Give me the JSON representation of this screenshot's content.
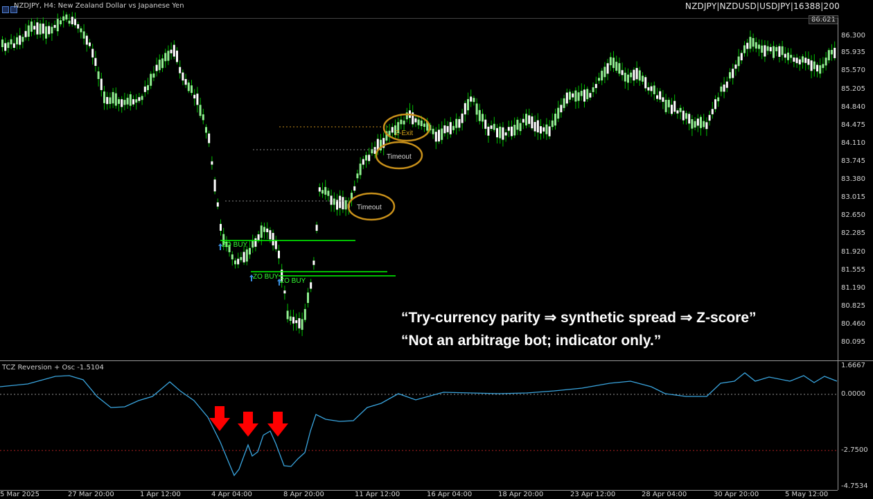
{
  "window": {
    "title": "NZDJPY, H4:  New Zealand Dollar vs Japanese Yen",
    "symbols": "NZDJPY|NZDUSD|USDJPY|16388|200",
    "current_price": "86.621"
  },
  "price_axis": {
    "labels": [
      "86.300",
      "85.935",
      "85.570",
      "85.205",
      "84.840",
      "84.475",
      "84.110",
      "83.745",
      "83.380",
      "83.015",
      "82.650",
      "82.285",
      "81.920",
      "81.555",
      "81.190",
      "80.825",
      "80.460",
      "80.095"
    ]
  },
  "time_axis": {
    "labels": [
      "5 Mar 2025",
      "27 Mar 20:00",
      "1 Apr 12:00",
      "4 Apr 04:00",
      "8 Apr 20:00",
      "11 Apr 12:00",
      "16 Apr 04:00",
      "18 Apr 20:00",
      "23 Apr 12:00",
      "28 Apr 04:00",
      "30 Apr 20:00",
      "5 May 12:00"
    ]
  },
  "annotations": {
    "quote_line_1": "“Try-currency parity ⇒ synthetic spread ⇒ Z-score”",
    "quote_line_2": "“Not an arbitrage bot; indicator only.”",
    "signals": [
      "ZO BUY",
      "ZO BUY",
      "ZO BUY"
    ],
    "exits": [
      "Z-Exit",
      "Timeout",
      "Timeout"
    ]
  },
  "oscillator": {
    "title": "TCZ Reversion + Osc -1.5104",
    "axis_labels": [
      "1.6667",
      "0.0000",
      "-2.7500",
      "-4.7534"
    ]
  },
  "colors": {
    "background": "#000000",
    "bull_candle": "#90ee90",
    "bear_candle": "#ffffff",
    "wick": "#00c000",
    "signal_line": "#00ff00",
    "osc_line": "#3aa6e0",
    "exit_circle": "#c8901a",
    "arrow": "#ff0000"
  }
}
